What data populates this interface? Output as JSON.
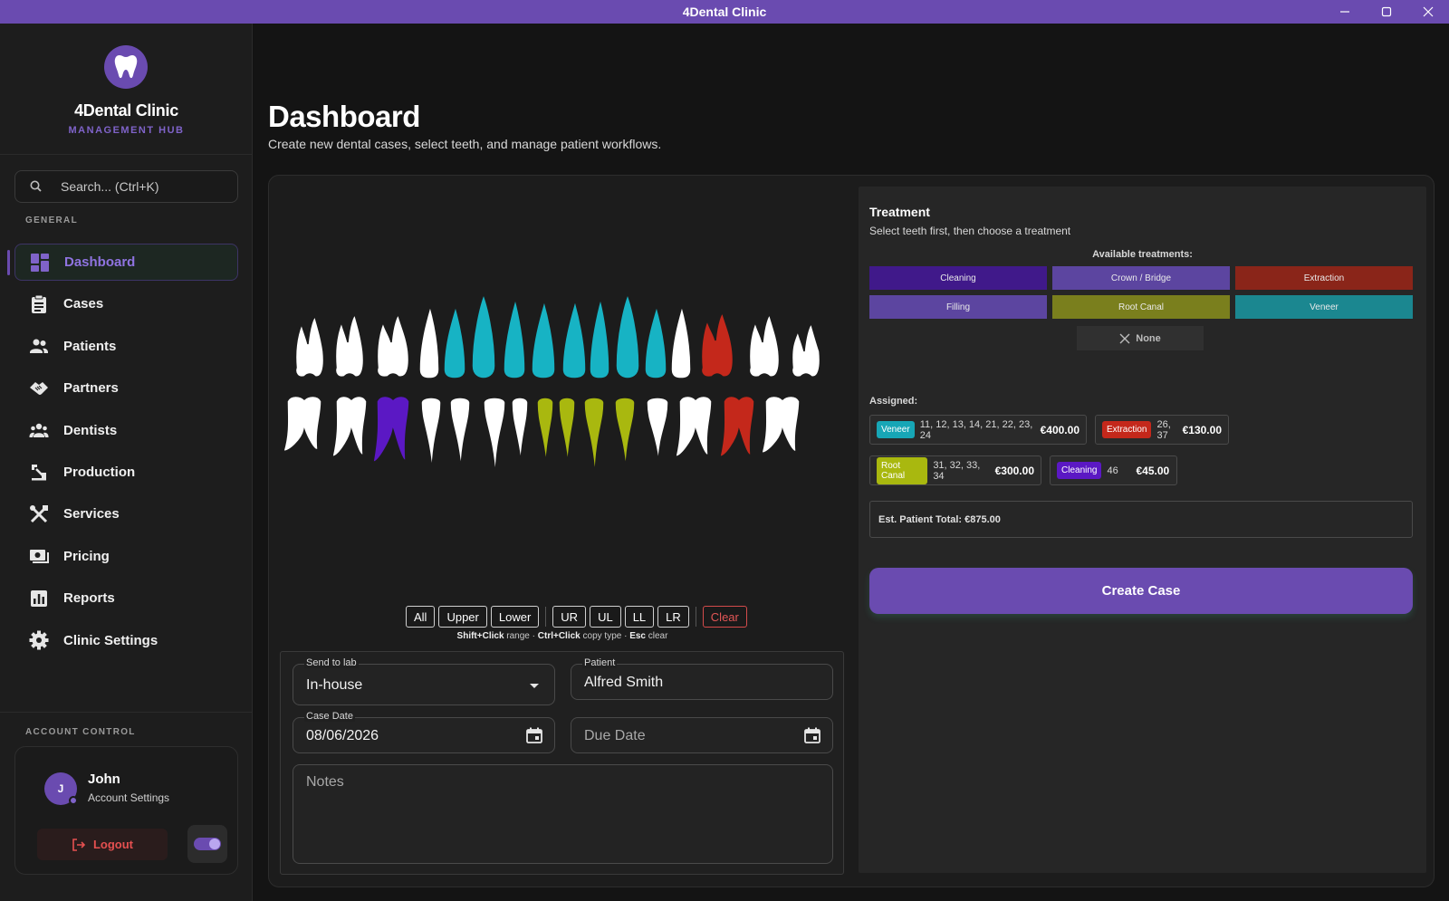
{
  "window": {
    "title": "4Dental Clinic"
  },
  "brand": {
    "name": "4Dental Clinic",
    "subtitle": "MANAGEMENT HUB"
  },
  "search": {
    "placeholder": "Search... (Ctrl+K)"
  },
  "nav": {
    "section_label": "GENERAL",
    "items": [
      {
        "label": "Dashboard",
        "icon": "dashboard-icon",
        "active": true
      },
      {
        "label": "Cases",
        "icon": "clipboard-icon"
      },
      {
        "label": "Patients",
        "icon": "people-icon"
      },
      {
        "label": "Partners",
        "icon": "handshake-icon"
      },
      {
        "label": "Dentists",
        "icon": "group-icon"
      },
      {
        "label": "Production",
        "icon": "precision-tool-icon"
      },
      {
        "label": "Services",
        "icon": "tools-icon"
      },
      {
        "label": "Pricing",
        "icon": "money-icon"
      },
      {
        "label": "Reports",
        "icon": "bar-chart-icon"
      },
      {
        "label": "Clinic Settings",
        "icon": "gear-icon"
      }
    ]
  },
  "account": {
    "section_label": "ACCOUNT CONTROL",
    "initial": "J",
    "name": "John",
    "settings_label": "Account Settings",
    "logout_label": "Logout",
    "theme_toggle_on": true
  },
  "page": {
    "title": "Dashboard",
    "subtitle": "Create new dental cases, select teeth, and manage patient workflows."
  },
  "teeth_chart": {
    "colors": {
      "veneer": "#17b3c4",
      "extraction": "#c4281b",
      "root_canal": "#a9b80f",
      "cleaning": "#5b18c4",
      "none": "#ffffff"
    },
    "upper": [
      "none",
      "none",
      "none",
      "none",
      "veneer",
      "veneer",
      "veneer",
      "veneer",
      "veneer",
      "veneer",
      "veneer",
      "veneer",
      "none",
      "extraction",
      "none",
      "none"
    ],
    "lower": [
      "none",
      "none",
      "cleaning",
      "none",
      "none",
      "none",
      "none",
      "root_canal",
      "root_canal",
      "root_canal",
      "root_canal",
      "none",
      "none",
      "extraction",
      "none"
    ]
  },
  "quick_select": {
    "buttons": [
      "All",
      "Upper",
      "Lower"
    ],
    "quadrants": [
      "UR",
      "UL",
      "LL",
      "LR"
    ],
    "clear_label": "Clear",
    "hint_parts": [
      {
        "b": "Shift+Click",
        "t": " range · "
      },
      {
        "b": "Ctrl+Click",
        "t": " copy type · "
      },
      {
        "b": "Esc",
        "t": " clear"
      }
    ]
  },
  "form": {
    "send_to_lab": {
      "label": "Send to lab",
      "value": "In-house"
    },
    "patient": {
      "label": "Patient",
      "value": "Alfred Smith"
    },
    "case_date": {
      "label": "Case Date",
      "value": "08/06/2026"
    },
    "due_date": {
      "placeholder": "Due Date"
    },
    "notes": {
      "placeholder": "Notes"
    }
  },
  "treatment": {
    "title": "Treatment",
    "subtitle": "Select teeth first, then choose a treatment",
    "available_label": "Available treatments:",
    "options": [
      {
        "label": "Cleaning",
        "color": "#40198a"
      },
      {
        "label": "Crown / Bridge",
        "color": "#5c45a0"
      },
      {
        "label": "Extraction",
        "color": "#8a2519"
      },
      {
        "label": "Filling",
        "color": "#5c45a0"
      },
      {
        "label": "Root Canal",
        "color": "#7a7f1d"
      },
      {
        "label": "Veneer",
        "color": "#1b8790"
      }
    ],
    "none_label": "None",
    "assigned_label": "Assigned:",
    "assigned": [
      {
        "tag": "Veneer",
        "color": "#17a6b6",
        "teeth": "11, 12, 13, 14, 21, 22, 23, 24",
        "price": "€400.00"
      },
      {
        "tag": "Extraction",
        "color": "#c4281b",
        "teeth": "26, 37",
        "price": "€130.00"
      },
      {
        "tag": "Root Canal",
        "color": "#a9b80f",
        "teeth": "31, 32, 33, 34",
        "price": "€300.00"
      },
      {
        "tag": "Cleaning",
        "color": "#5b18c4",
        "teeth": "46",
        "price": "€45.00"
      }
    ],
    "total_label": "Est. Patient Total: €875.00",
    "create_label": "Create Case"
  }
}
